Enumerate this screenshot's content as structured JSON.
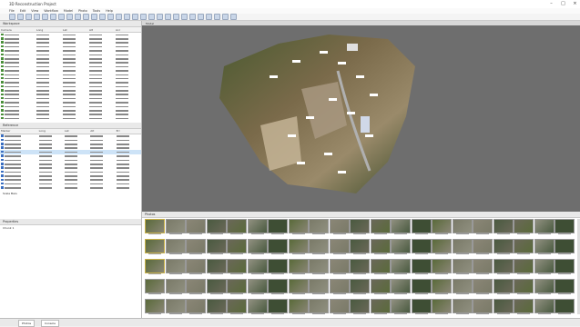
{
  "window": {
    "title": "3D Reconstruction Project"
  },
  "menu": [
    "File",
    "Edit",
    "View",
    "Workflow",
    "Model",
    "Photo",
    "Tools",
    "Help"
  ],
  "left_panel": {
    "workspace_label": "Workspace",
    "chunk_label": "Chunk 1",
    "reference_label": "Reference",
    "cameras_header": [
      "Camera",
      "Long",
      "Lat",
      "Alt",
      "Acc"
    ],
    "markers_header": [
      "Marker",
      "Long",
      "Lat",
      "Alt",
      "Err"
    ],
    "scalebars_label": "Scale Bars",
    "properties_label": "Properties"
  },
  "viewport": {
    "label": "Model",
    "background": "#6e6e6e"
  },
  "photos": {
    "label": "Photos",
    "count": 105
  },
  "status_tabs": [
    "Photos",
    "Console"
  ]
}
